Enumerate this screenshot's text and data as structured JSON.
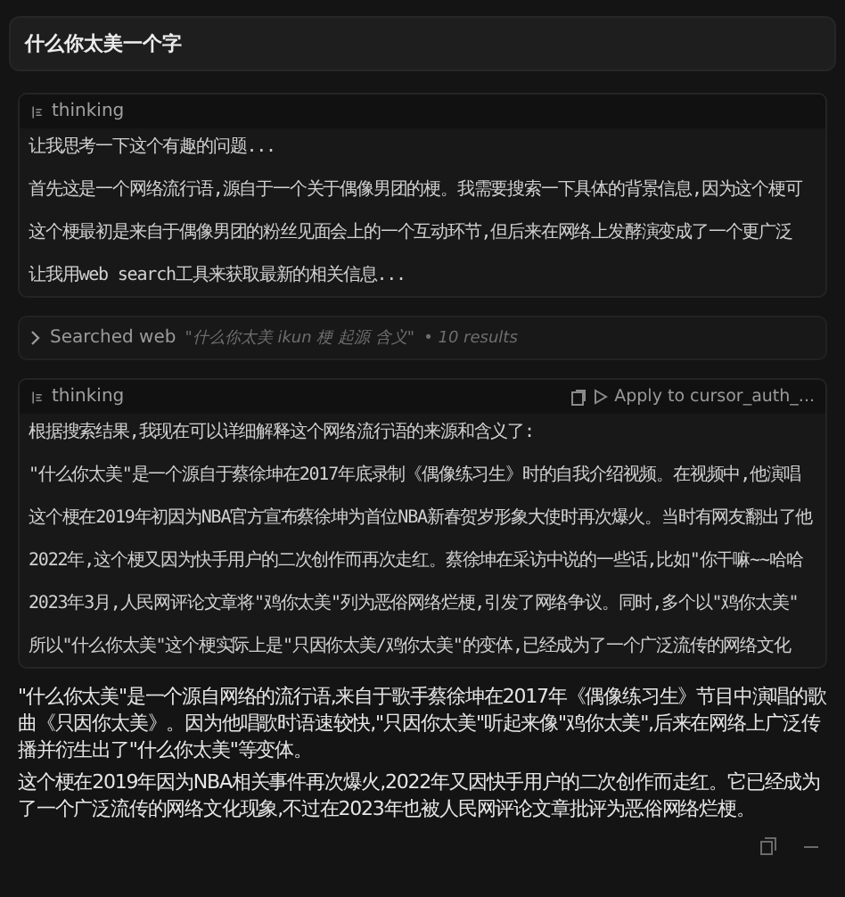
{
  "user_message": "什么你太美一个字",
  "items": [
    {
      "kind": "thinking",
      "label": "thinking",
      "lines": [
        "让我思考一下这个有趣的问题...",
        "首先这是一个网络流行语,源自于一个关于偶像男团的梗。我需要搜索一下具体的背景信息,因为这个梗可",
        "这个梗最初是来自于偶像男团的粉丝见面会上的一个互动环节,但后来在网络上发酵演变成了一个更广泛",
        "让我用web search工具来获取最新的相关信息..."
      ]
    },
    {
      "kind": "search",
      "label": "Searched web",
      "query": "\"什么你太美 ikun 梗 起源 含义\"",
      "count": "• 10 results"
    },
    {
      "kind": "thinking",
      "label": "thinking",
      "apply": "Apply to cursor_auth_...",
      "lines": [
        "根据搜索结果,我现在可以详细解释这个网络流行语的来源和含义了:",
        "\"什么你太美\"是一个源自于蔡徐坤在2017年底录制《偶像练习生》时的自我介绍视频。在视频中,他演唱",
        "这个梗在2019年初因为NBA官方宣布蔡徐坤为首位NBA新春贺岁形象大使时再次爆火。当时有网友翻出了他",
        "2022年,这个梗又因为快手用户的二次创作而再次走红。蔡徐坤在采访中说的一些话,比如\"你干嘛~~哈哈",
        "2023年3月,人民网评论文章将\"鸡你太美\"列为恶俗网络烂梗,引发了网络争议。同时,多个以\"鸡你太美\"",
        "所以\"什么你太美\"这个梗实际上是\"只因你太美/鸡你太美\"的变体,已经成为了一个广泛流传的网络文化"
      ]
    }
  ],
  "answer": [
    "\"什么你太美\"是一个源自网络的流行语,来自于歌手蔡徐坤在2017年《偶像练习生》节目中演唱的歌曲《只因你太美》。因为他唱歌时语速较快,\"只因你太美\"听起来像\"鸡你太美\",后来在网络上广泛传播并衍生出了\"什么你太美\"等变体。",
    "这个梗在2019年因为NBA相关事件再次爆火,2022年又因快手用户的二次创作而走红。它已经成为了一个广泛流传的网络文化现象,不过在2023年也被人民网评论文章批评为恶俗网络烂梗。"
  ]
}
